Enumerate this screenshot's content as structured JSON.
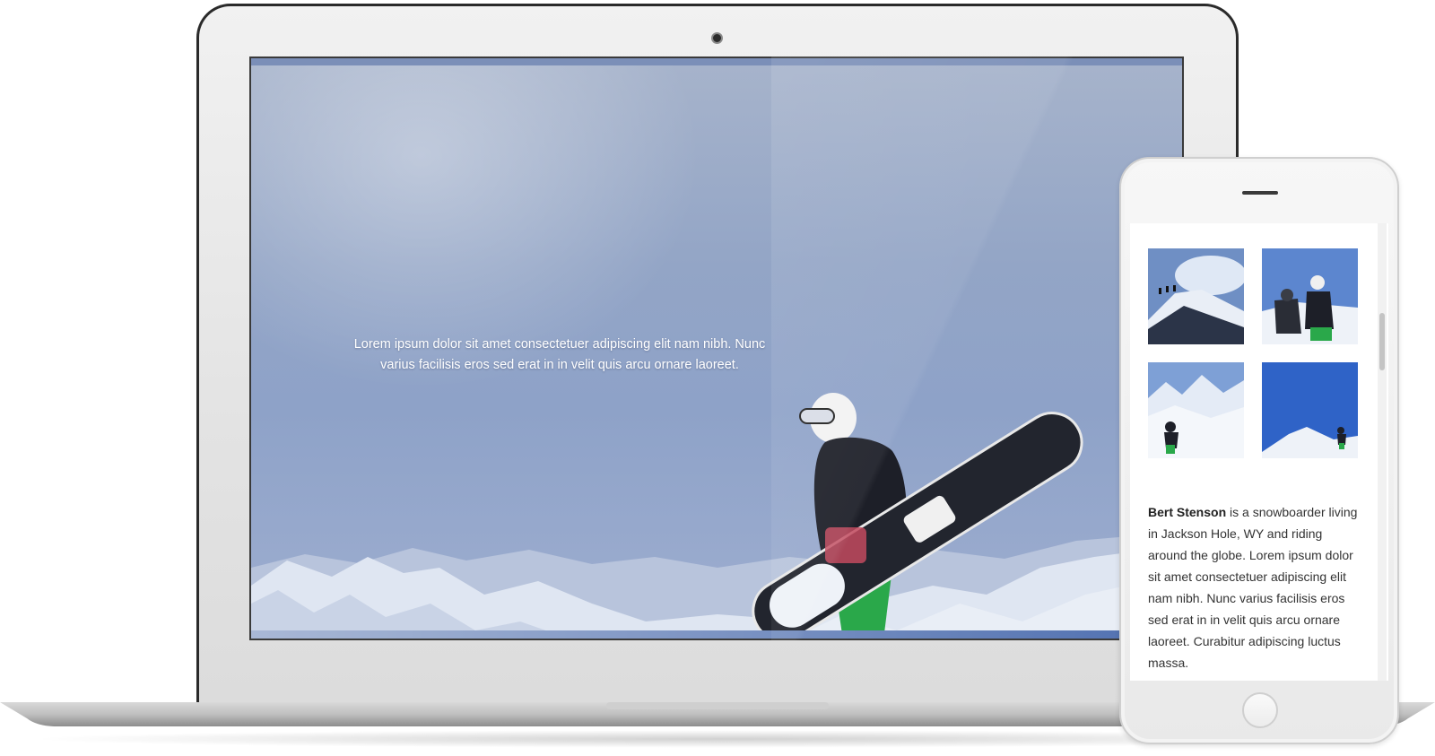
{
  "laptop": {
    "hero_text": "Lorem ipsum dolor sit amet consectetuer adipiscing elit nam nibh. Nunc varius facilisis eros sed erat in in velit quis arcu ornare laoreet.",
    "hero_image_icon": "snowboarder-photo-icon"
  },
  "phone": {
    "gallery": [
      {
        "icon": "mountain-ridge-hikers-photo-icon"
      },
      {
        "icon": "snowboarders-photo-icon"
      },
      {
        "icon": "snowy-peaks-rider-photo-icon"
      },
      {
        "icon": "blue-sky-rider-photo-icon"
      }
    ],
    "bio_name": "Bert Stenson",
    "bio_text": " is a snowboarder living in Jackson Hole, WY and riding around the globe. Lorem ipsum dolor sit amet consectetuer adipiscing elit nam nibh. Nunc varius facilisis eros sed erat in in velit quis arcu ornare laoreet. Curabitur adipiscing luctus massa."
  },
  "colors": {
    "sky": "#93a5c6",
    "jacket": "#1d1f28",
    "pants": "#2aa84a",
    "snow": "#eef2f8"
  }
}
